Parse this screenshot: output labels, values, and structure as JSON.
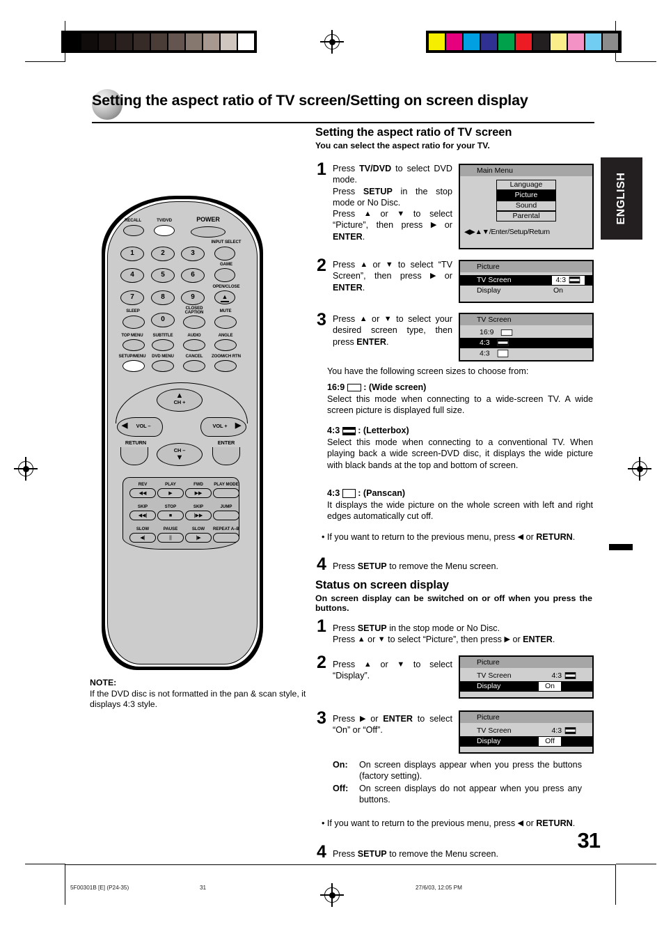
{
  "page": {
    "chapter_title": "Setting the aspect ratio of TV screen/Setting on screen display",
    "language_tab": "ENGLISH",
    "page_number": "31"
  },
  "footer": {
    "file_code": "5F00301B [E] (P24-35)",
    "page_label": "31",
    "timestamp": "27/6/03, 12:05 PM"
  },
  "section_aspect": {
    "heading": "Setting the aspect ratio of TV screen",
    "subheading": "You can select the aspect ratio for your TV.",
    "steps": [
      {
        "num": "1",
        "lines": [
          "Press <b>TV/DVD</b> to select DVD mode.",
          "Press <b>SETUP</b> in the stop mode or No Disc.",
          "Press <span class=\"arrow\">▲</span> or <span class=\"arrow\">▼</span> to select “Picture”, then press <span class=\"arrow\">▶</span> or <b>ENTER</b>."
        ]
      },
      {
        "num": "2",
        "lines": [
          "Press <span class=\"arrow\">▲</span> or <span class=\"arrow\">▼</span> to select “TV Screen”, then press <span class=\"arrow\">▶</span> or <b>ENTER</b>."
        ]
      },
      {
        "num": "3",
        "lines": [
          "Press <span class=\"arrow\">▲</span> or <span class=\"arrow\">▼</span> to select your desired screen type, then press <b>ENTER</b>."
        ]
      },
      {
        "num": "4",
        "lines": [
          "Press <b>SETUP</b> to remove the Menu screen."
        ]
      }
    ],
    "intro_sizes": "You have the following screen sizes to choose from:",
    "modes": [
      {
        "label": "16:9",
        "glyph": "wide",
        "name": ": (Wide screen)",
        "body": "Select this mode when connecting to a wide-screen TV. A wide screen picture is displayed full size."
      },
      {
        "label": "4:3",
        "glyph": "letterbox",
        "name": ": (Letterbox)",
        "body": "Select this mode when connecting to a conventional TV. When playing back a wide screen-DVD disc, it displays the wide picture with black bands at the top and bottom of screen."
      },
      {
        "label": "4:3",
        "glyph": "panscan",
        "name": ": (Panscan)",
        "body": "It displays the wide picture on the whole screen with left and right edges automatically cut off."
      }
    ],
    "return_bullet": "• If you want to return to the previous menu, press <span class=\"arrow\">◀</span> or <b>RETURN</b>."
  },
  "section_status": {
    "heading": "Status on screen display",
    "subheading": "On screen display can be switched on or off when you press the buttons.",
    "steps": [
      {
        "num": "1",
        "lines": [
          "Press <b>SETUP</b> in the stop mode or No Disc.",
          "Press <span class=\"arrow\">▲</span> or <span class=\"arrow\">▼</span> to select “Picture”, then press <span class=\"arrow\">▶</span> or <b>ENTER</b>."
        ]
      },
      {
        "num": "2",
        "lines": [
          "Press <span class=\"arrow\">▲</span> or <span class=\"arrow\">▼</span> to select “Display”."
        ]
      },
      {
        "num": "3",
        "lines": [
          "Press <span class=\"arrow\">▶</span> or <b>ENTER</b> to select “On” or “Off”."
        ]
      },
      {
        "num": "4",
        "lines": [
          "Press <b>SETUP</b> to remove the Menu screen."
        ]
      }
    ],
    "definitions": [
      {
        "term": "On:",
        "text": "On screen displays appear when you press the buttons (factory setting)."
      },
      {
        "term": "Off:",
        "text": "On screen displays do not appear when you press any buttons."
      }
    ],
    "return_bullet": "• If you want to return to the previous menu, press <span class=\"arrow\">◀</span> or <b>RETURN</b>."
  },
  "osd": {
    "main_menu": {
      "title": "Main Menu",
      "items": [
        {
          "label": "Language",
          "selected": false
        },
        {
          "label": "Picture",
          "selected": true
        },
        {
          "label": "Sound",
          "selected": false
        },
        {
          "label": "Parental",
          "selected": false
        }
      ],
      "footer": "◀▶▲▼/Enter/Setup/Return"
    },
    "picture_tvscreen": {
      "title": "Picture",
      "rows": [
        {
          "label": "TV Screen",
          "value": "4:3",
          "glyph": "letterbox",
          "selected": true,
          "boxed": true
        },
        {
          "label": "Display",
          "value": "On",
          "glyph": "",
          "selected": false,
          "boxed": false
        }
      ]
    },
    "tv_screen": {
      "title": "TV Screen",
      "rows": [
        {
          "label": "16:9",
          "glyph": "wide",
          "selected": false
        },
        {
          "label": "4:3",
          "glyph": "letterbox",
          "selected": true
        },
        {
          "label": "4:3",
          "glyph": "panscan",
          "selected": false
        }
      ]
    },
    "picture_display_on": {
      "title": "Picture",
      "rows": [
        {
          "label": "TV Screen",
          "value": "4:3",
          "glyph": "letterbox",
          "selected": false,
          "boxed": false
        },
        {
          "label": "Display",
          "value": "On",
          "glyph": "",
          "selected": true,
          "boxed": true
        }
      ]
    },
    "picture_display_off": {
      "title": "Picture",
      "rows": [
        {
          "label": "TV Screen",
          "value": "4:3",
          "glyph": "letterbox",
          "selected": false,
          "boxed": false
        },
        {
          "label": "Display",
          "value": "Off",
          "glyph": "",
          "selected": true,
          "boxed": true
        }
      ]
    }
  },
  "note": {
    "title": "NOTE:",
    "text": "If the DVD disc is not formatted in the pan & scan style, it displays 4:3 style."
  },
  "remote": {
    "row_labels": {
      "recall": "RECALL",
      "tvdvd": "TV/DVD",
      "power": "POWER",
      "input_select": "INPUT SELECT",
      "game": "GAME",
      "open_close": "OPEN/CLOSE",
      "sleep": "SLEEP",
      "closed_caption": "CLOSED\nCAPTION",
      "mute": "MUTE",
      "top_menu": "TOP MENU",
      "subtitle": "SUBTITLE",
      "audio": "AUDIO",
      "angle": "ANGLE",
      "setup_menu": "SETUP/MENU",
      "dvd_menu": "DVD MENU",
      "cancel": "CANCEL",
      "zoom_ch_rtn": "ZOOM/CH RTN",
      "ch_up": "CH +",
      "ch_down": "CH –",
      "vol_down": "VOL –",
      "vol_up": "VOL +",
      "return": "RETURN",
      "enter": "ENTER"
    },
    "numbers": [
      "1",
      "2",
      "3",
      "4",
      "5",
      "6",
      "7",
      "8",
      "9",
      "0"
    ],
    "transport": [
      {
        "label": "REV",
        "glyph": "◀◀"
      },
      {
        "label": "PLAY",
        "glyph": "▶"
      },
      {
        "label": "FWD",
        "glyph": "▶▶"
      },
      {
        "label": "PLAY MODE",
        "glyph": ""
      },
      {
        "label": "SKIP",
        "glyph": "◀◀|"
      },
      {
        "label": "STOP",
        "glyph": "■"
      },
      {
        "label": "SKIP",
        "glyph": "|▶▶"
      },
      {
        "label": "JUMP",
        "glyph": ""
      },
      {
        "label": "SLOW",
        "glyph": "◀|"
      },
      {
        "label": "PAUSE",
        "glyph": "||"
      },
      {
        "label": "SLOW",
        "glyph": "|▶"
      },
      {
        "label": "REPEAT A–B",
        "glyph": ""
      }
    ]
  },
  "colorbars": {
    "grayscale": [
      "#000000",
      "#110c0c",
      "#1d1615",
      "#2a201e",
      "#362b27",
      "#4a3d37",
      "#655550",
      "#86776f",
      "#a79890",
      "#d0c6c0",
      "#ffffff"
    ],
    "color": [
      "#f5ee00",
      "#e6007e",
      "#00a0e3",
      "#2e3192",
      "#00a14b",
      "#ed1c24",
      "#231f20",
      "#f9ee8a",
      "#f392c4",
      "#71cdf2",
      "#8c8c8c"
    ]
  }
}
